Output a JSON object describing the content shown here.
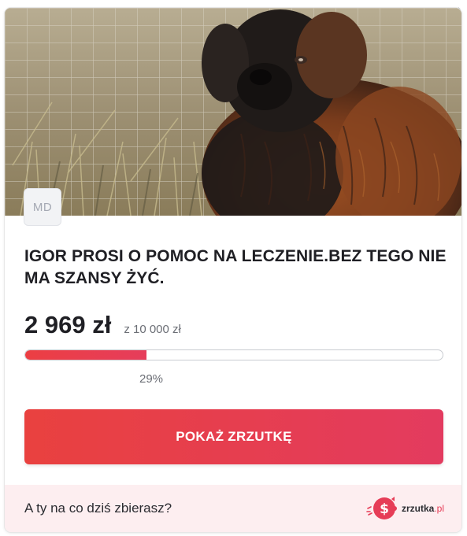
{
  "widget": {
    "avatar_initials": "MD",
    "title": "IGOR PROSI O POMOC NA LECZENIE.BEZ TEGO NIE MA SZANSY ŻYĆ.",
    "raised": "2 969 zł",
    "goal": "z 10 000 zł",
    "progress_percent_label": "29%",
    "progress_fraction": 0.29,
    "cta_label": "POKAŻ ZRZUTKĘ",
    "accent_color": "#e9413f"
  },
  "footer": {
    "prompt": "A ty na co dziś zbierasz?",
    "brand_name": "zrzutka",
    "brand_tld": ".pl",
    "brand_icon": "piggy-bank-dollar-icon",
    "background_color": "#fdeef0"
  },
  "corner_icon": "chevron-right-icon"
}
